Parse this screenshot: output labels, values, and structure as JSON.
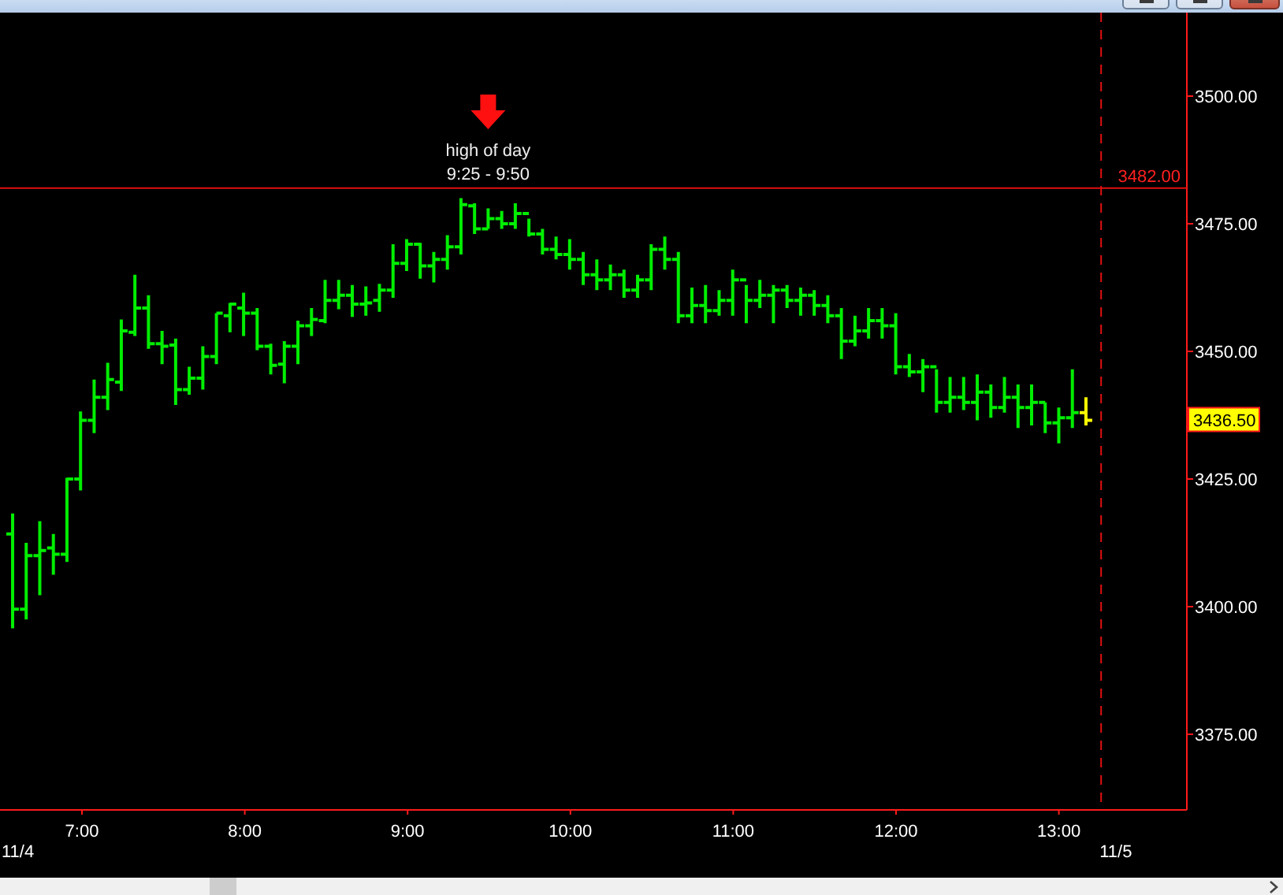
{
  "window": {
    "buttons": [
      {
        "kind": "minimize"
      },
      {
        "kind": "maximize"
      },
      {
        "kind": "close"
      }
    ]
  },
  "chart": {
    "callout": {
      "text": "high of day",
      "time_range": "9:25 - 9:50"
    },
    "high_of_day": {
      "label": "3482.00"
    },
    "y_axis_labels": [
      "3500.00",
      "3475.00",
      "3450.00",
      "3425.00",
      "3400.00",
      "3375.00"
    ],
    "last_price": {
      "label": "3436.50"
    },
    "x_axis_labels": [
      "7:00",
      "8:00",
      "9:00",
      "10:00",
      "11:00",
      "12:00",
      "13:00"
    ],
    "date_labels": [
      "11/4",
      "11/5"
    ]
  }
}
